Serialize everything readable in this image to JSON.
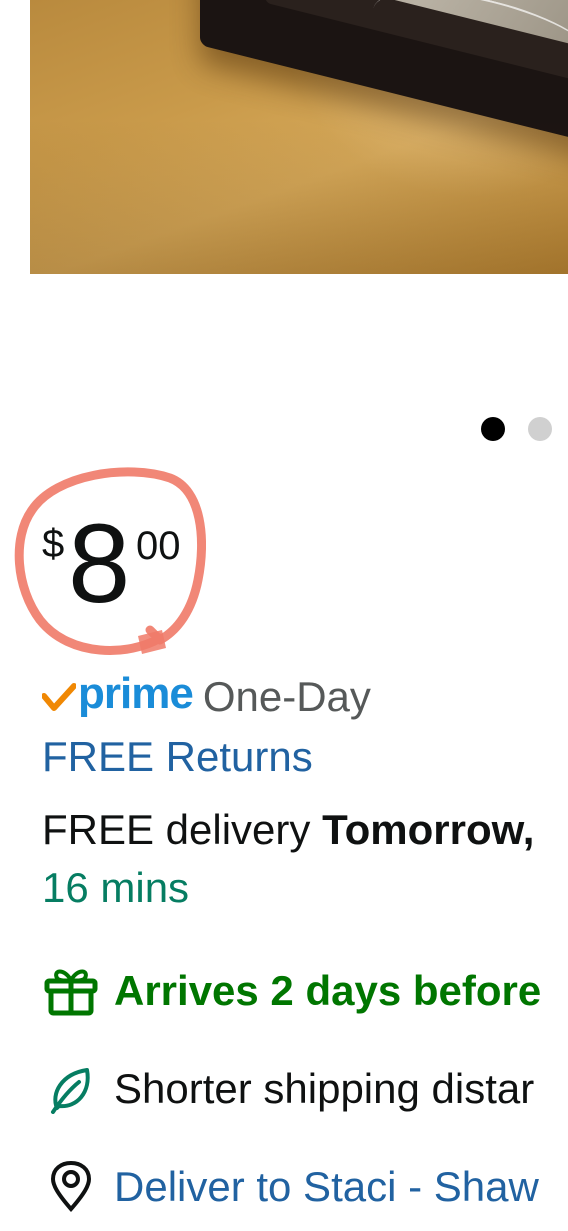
{
  "gallery": {
    "dots": 2,
    "active_index": 0
  },
  "price": {
    "symbol": "$",
    "whole": "8",
    "fraction": "00"
  },
  "prime": {
    "logo_text": "prime",
    "speed": "One-Day"
  },
  "returns": {
    "label": "FREE Returns"
  },
  "delivery": {
    "prefix": "FREE delivery ",
    "date": "Tomorrow,",
    "countdown": "16 mins"
  },
  "badges": {
    "arrives": "Arrives 2 days before",
    "shipping": "Shorter shipping distar"
  },
  "deliver_to": {
    "label": "Deliver to Staci - Shaw"
  },
  "colors": {
    "prime_blue": "#1a8cd8",
    "prime_check": "#f08804",
    "link_blue": "#2162a1",
    "countdown_teal": "#067d62",
    "arrives_green": "#007600",
    "annotation": "#f07a68"
  },
  "icons": {
    "gift": "gift-icon",
    "leaf": "leaf-icon",
    "location": "location-pin-icon",
    "prime_check": "prime-check-icon"
  }
}
